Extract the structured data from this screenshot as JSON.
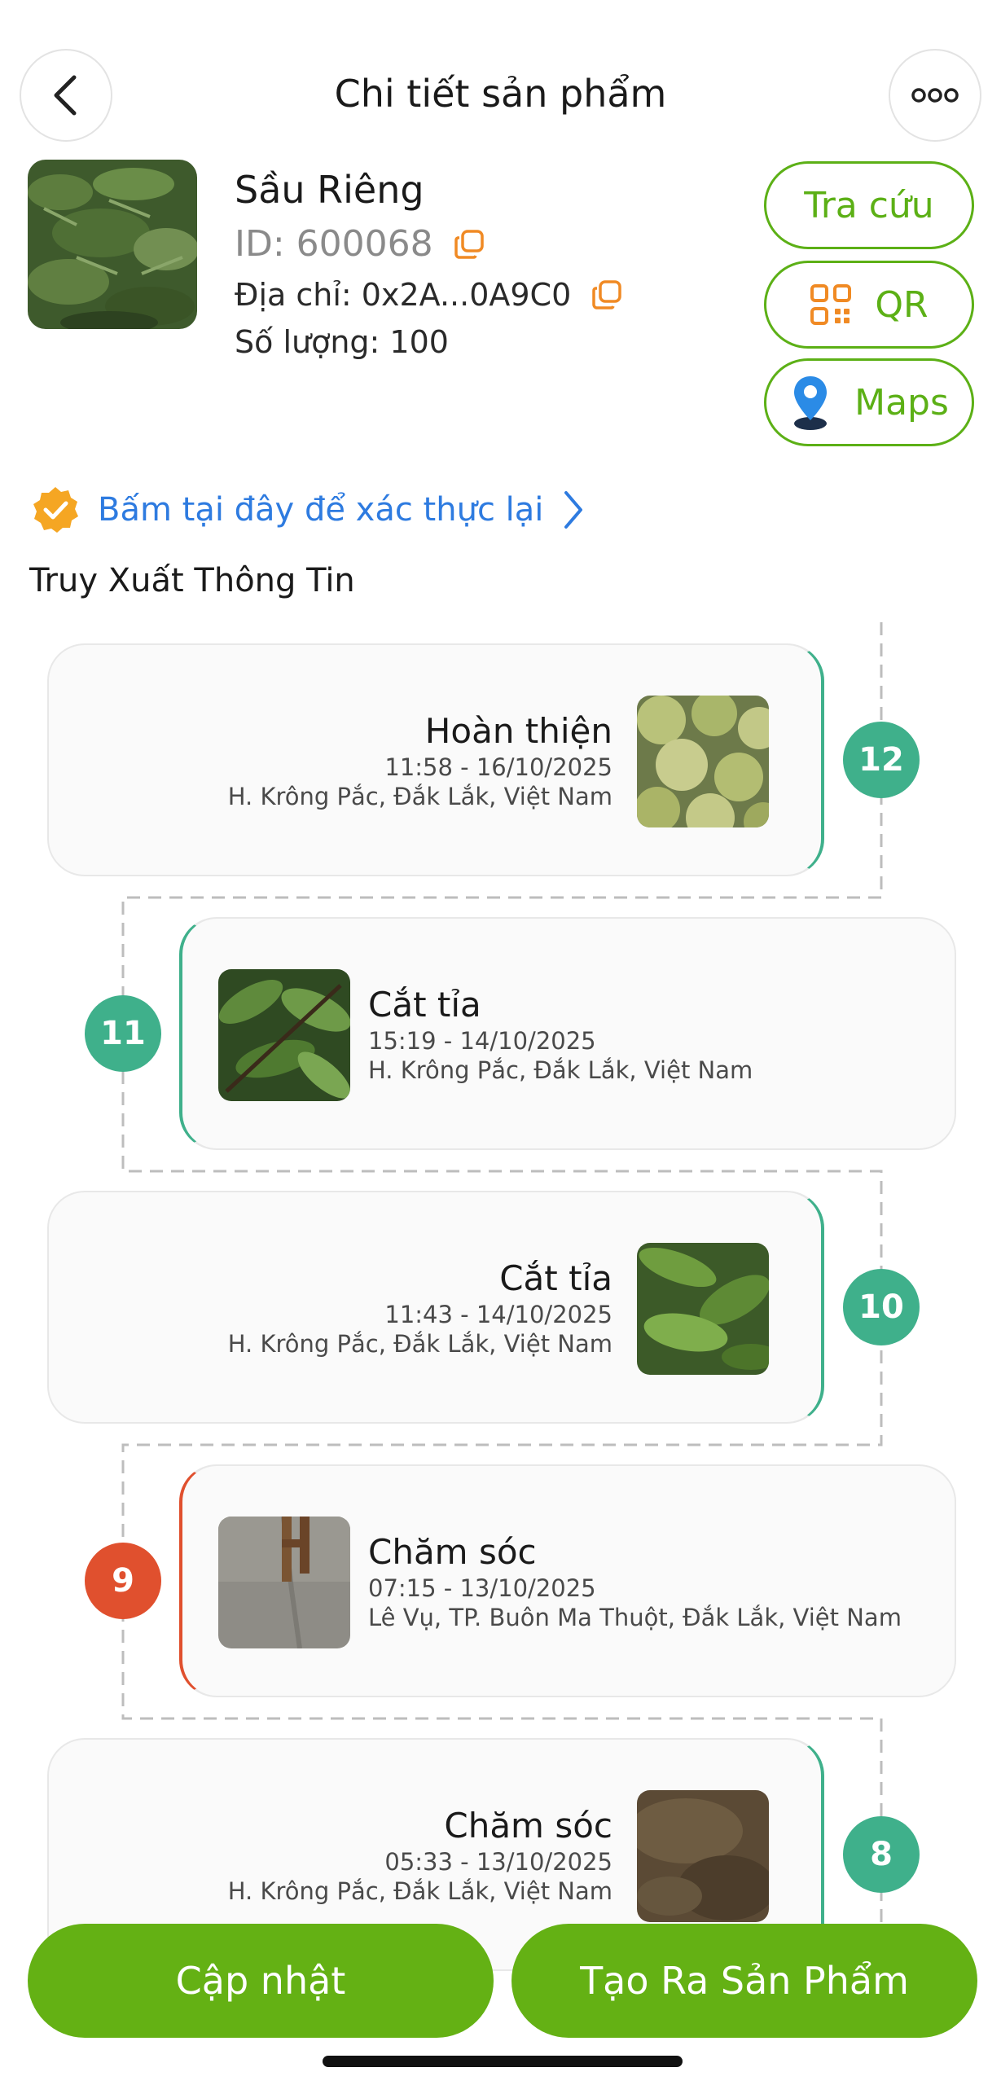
{
  "header": {
    "title": "Chi tiết sản phẩm",
    "back_icon": "chevron-left-icon",
    "more_icon": "more-horizontal-icon"
  },
  "product": {
    "name": "Sầu Riêng",
    "id_text": "ID: 600068",
    "address_text": "Địa chỉ: 0x2A...0A9C0",
    "quantity_text": "Số lượng: 100"
  },
  "actions": {
    "lookup_label": "Tra cứu",
    "qr_label": "QR",
    "maps_label": "Maps"
  },
  "verify": {
    "text": "Bấm tại đây để xác thực lại",
    "icon": "verified-badge-icon"
  },
  "section_title": "Truy Xuất Thông Tin",
  "timeline": [
    {
      "step": "12",
      "title": "Hoàn thiện",
      "time": "11:58 - 16/10/2025",
      "location": "H. Krông Pắc, Đắk Lắk, Việt Nam",
      "status": "green"
    },
    {
      "step": "11",
      "title": "Cắt tỉa",
      "time": "15:19 - 14/10/2025",
      "location": "H. Krông Pắc, Đắk Lắk, Việt Nam",
      "status": "green"
    },
    {
      "step": "10",
      "title": "Cắt tỉa",
      "time": "11:43 - 14/10/2025",
      "location": "H. Krông Pắc, Đắk Lắk, Việt Nam",
      "status": "green"
    },
    {
      "step": "9",
      "title": "Chăm sóc",
      "time": "07:15 - 13/10/2025",
      "location": "Lê Vụ, TP. Buôn Ma Thuột, Đắk Lắk, Việt Nam",
      "status": "red"
    },
    {
      "step": "8",
      "title": "Chăm sóc",
      "time": "05:33 - 13/10/2025",
      "location": "H. Krông Pắc, Đắk Lắk, Việt Nam",
      "status": "green"
    }
  ],
  "bottom": {
    "update_label": "Cập nhật",
    "create_label": "Tạo Ra Sản Phẩm"
  },
  "colors": {
    "accent": "#64b114",
    "timeline_green": "#3fb08b",
    "timeline_red": "#e0502e",
    "link_blue": "#2e7be0"
  }
}
